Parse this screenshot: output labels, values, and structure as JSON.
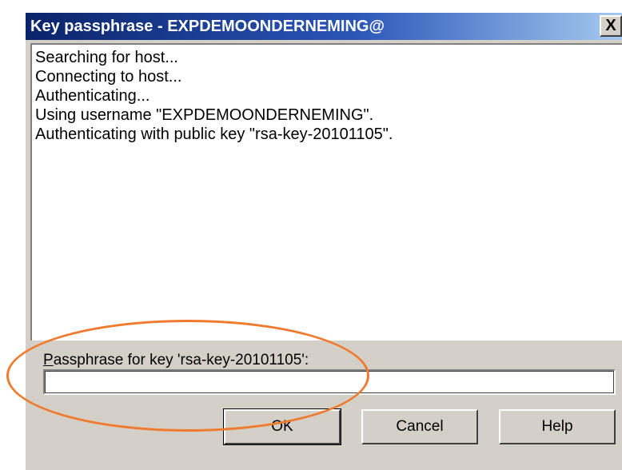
{
  "window": {
    "title": "Key passphrase - EXPDEMOONDERNEMING@",
    "close_label": "X"
  },
  "log": {
    "lines": [
      "Searching for host...",
      "Connecting to host...",
      "Authenticating...",
      "Using username \"EXPDEMOONDERNEMING\".",
      "Authenticating with public key \"rsa-key-20101105\"."
    ]
  },
  "passphrase": {
    "label_mnemonic": "P",
    "label_rest": "assphrase for key 'rsa-key-20101105':",
    "value": "",
    "placeholder": ""
  },
  "buttons": {
    "ok": "OK",
    "cancel": "Cancel",
    "help": "Help"
  },
  "annotation": {
    "color": "#f07a2e"
  }
}
